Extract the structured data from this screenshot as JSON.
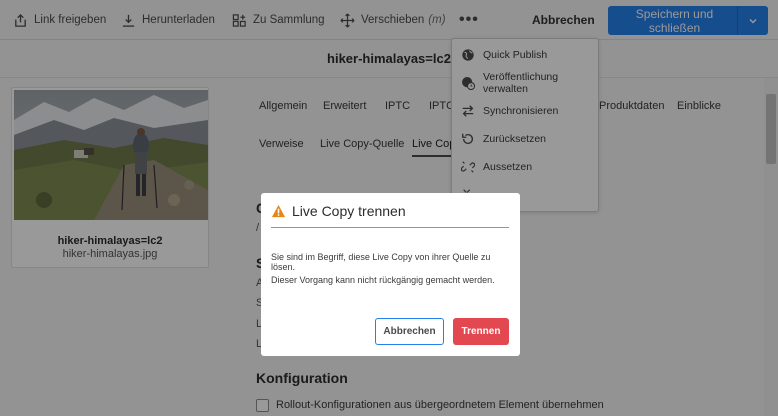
{
  "toolbar": {
    "share_link": "Link freigeben",
    "download": "Herunterladen",
    "add_to_collection": "Zu Sammlung",
    "move": "Verschieben",
    "move_shortcut": "(m)",
    "more": "•••",
    "cancel": "Abbrechen",
    "save_close": "Speichern und schließen"
  },
  "title": "hiker-himalayas=lc2",
  "asset": {
    "name": "hiker-himalayas=lc2",
    "file": "hiker-himalayas.jpg"
  },
  "tabs_row1": [
    "Allgemein",
    "Erweitert",
    "IPTC",
    "IPTC-",
    "Produktdaten",
    "Einblicke"
  ],
  "tabs_row2": [
    "Verweise",
    "Live Copy-Quelle",
    "Live Copy"
  ],
  "main": {
    "section_initial": "C",
    "section2_initial": "S",
    "row_initials": [
      "A",
      "S",
      "L",
      "L"
    ],
    "slash": "/",
    "config_title": "Konfiguration",
    "inherit_label": "Rollout-Konfigurationen aus übergeordnetem Element übernehmen"
  },
  "menu": {
    "items": [
      {
        "label": "Quick Publish",
        "icon": "globe-icon"
      },
      {
        "label": "Veröffentlichung verwalten",
        "icon": "globe-clock-icon"
      },
      {
        "label": "Synchronisieren",
        "icon": "sync-arrows-icon"
      },
      {
        "label": "Zurücksetzen",
        "icon": "revert-icon"
      },
      {
        "label": "Aussetzen",
        "icon": "unlink-icon"
      }
    ]
  },
  "dialog": {
    "title": "Live Copy trennen",
    "message1": "Sie sind im Begriff, diese Live Copy von ihrer Quelle zu lösen.",
    "message2": "Dieser Vorgang kann nicht rückgängig gemacht werden.",
    "cancel": "Abbrechen",
    "confirm": "Trennen"
  },
  "colors": {
    "primary": "#2680eb",
    "danger": "#e34850",
    "warning": "#e68619"
  }
}
